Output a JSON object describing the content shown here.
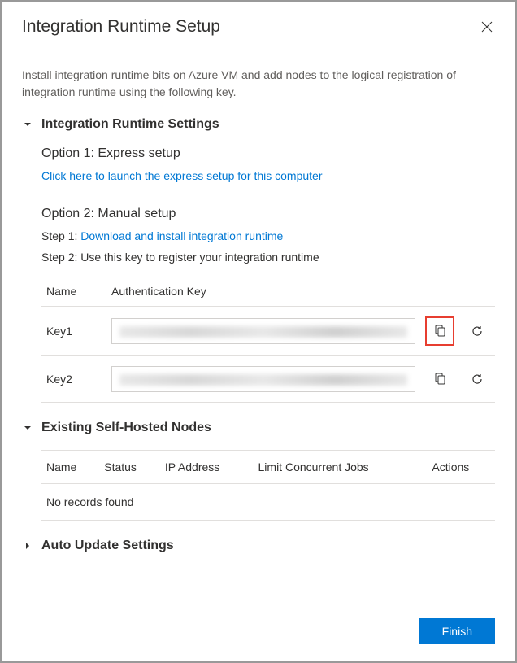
{
  "header": {
    "title": "Integration Runtime Setup"
  },
  "description": "Install integration runtime bits on Azure VM and add nodes to the logical registration of integration runtime using the following key.",
  "sections": {
    "settings": {
      "title": "Integration Runtime Settings",
      "option1": {
        "title": "Option 1: Express setup",
        "link": "Click here to launch the express setup for this computer"
      },
      "option2": {
        "title": "Option 2: Manual setup",
        "step1_prefix": "Step 1: ",
        "step1_link": "Download and install integration runtime",
        "step2": "Step 2: Use this key to register your integration runtime"
      },
      "keys": {
        "col_name": "Name",
        "col_authkey": "Authentication Key",
        "rows": [
          {
            "name": "Key1"
          },
          {
            "name": "Key2"
          }
        ]
      }
    },
    "nodes": {
      "title": "Existing Self-Hosted Nodes",
      "columns": {
        "name": "Name",
        "status": "Status",
        "ip": "IP Address",
        "limit": "Limit Concurrent Jobs",
        "actions": "Actions"
      },
      "empty": "No records found"
    },
    "auto_update": {
      "title": "Auto Update Settings"
    }
  },
  "footer": {
    "finish": "Finish"
  }
}
